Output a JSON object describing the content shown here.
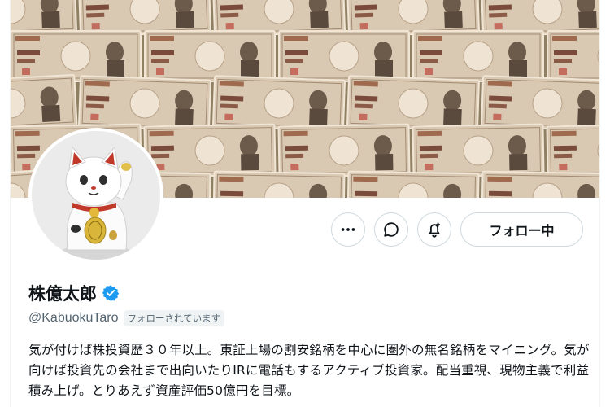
{
  "profile": {
    "display_name": "株億太郎",
    "handle": "@KabuokuTaro",
    "follows_you_label": "フォローされています",
    "bio": "気が付けば株投資歴３０年以上。東証上場の割安銘柄を中心に圏外の無名銘柄をマイニング。気が向けば投資先の会社まで出向いたりIRに電話もするアクティブ投資家。配当重視、現物主義で利益積み上げ。とりあえず資産評価50億円を目標。",
    "verified": true
  },
  "actions": {
    "more_icon": "more-icon",
    "message_icon": "message-icon",
    "notify_icon": "notification-bell-icon",
    "follow_label": "フォロー中"
  },
  "banner": {
    "bill_top_text": "日本銀行券",
    "bill_value": "10000",
    "bill_center_text": "壱万円"
  },
  "colors": {
    "verified_blue": "#1d9bf0",
    "text_primary": "#0f1419",
    "text_secondary": "#536471",
    "border": "#cfd9de"
  }
}
